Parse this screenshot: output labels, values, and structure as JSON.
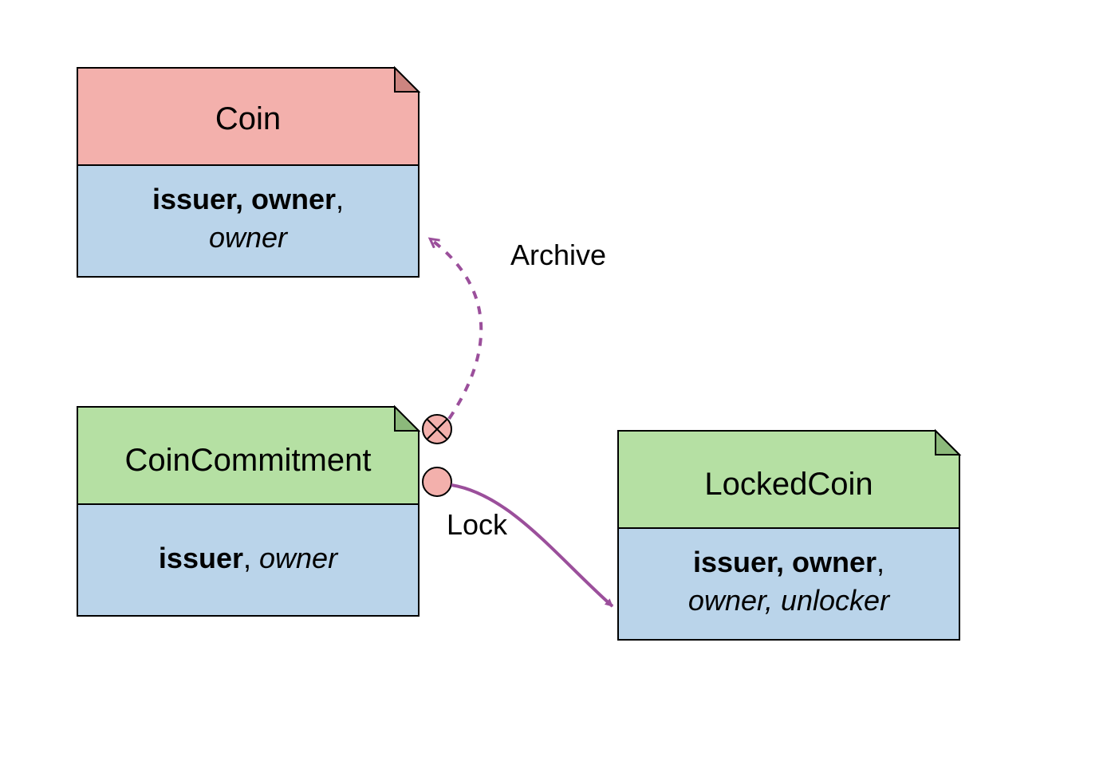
{
  "cards": {
    "coin": {
      "title": "Coin",
      "line1_bold": "issuer, owner",
      "line1_tail": ",",
      "line2_italic": "owner"
    },
    "coinCommitment": {
      "title": "CoinCommitment",
      "line1_bold": "issuer",
      "line1_tail": ", ",
      "line1_italic": "owner"
    },
    "lockedCoin": {
      "title": "LockedCoin",
      "line1_bold": "issuer, owner",
      "line1_tail": ",",
      "line2_italic": "owner, unlocker"
    }
  },
  "labels": {
    "archive": "Archive",
    "lock": "Lock"
  },
  "colors": {
    "pinkHeader": "#f3b0ac",
    "pinkHeaderFold": "#cc8580",
    "greenHeader": "#b5e0a3",
    "greenHeaderFold": "#8cb97b",
    "blueBody": "#bad4ea",
    "stroke": "#000000",
    "arrow": "#9b4f9b",
    "choiceFill": "#f3b0ac"
  }
}
